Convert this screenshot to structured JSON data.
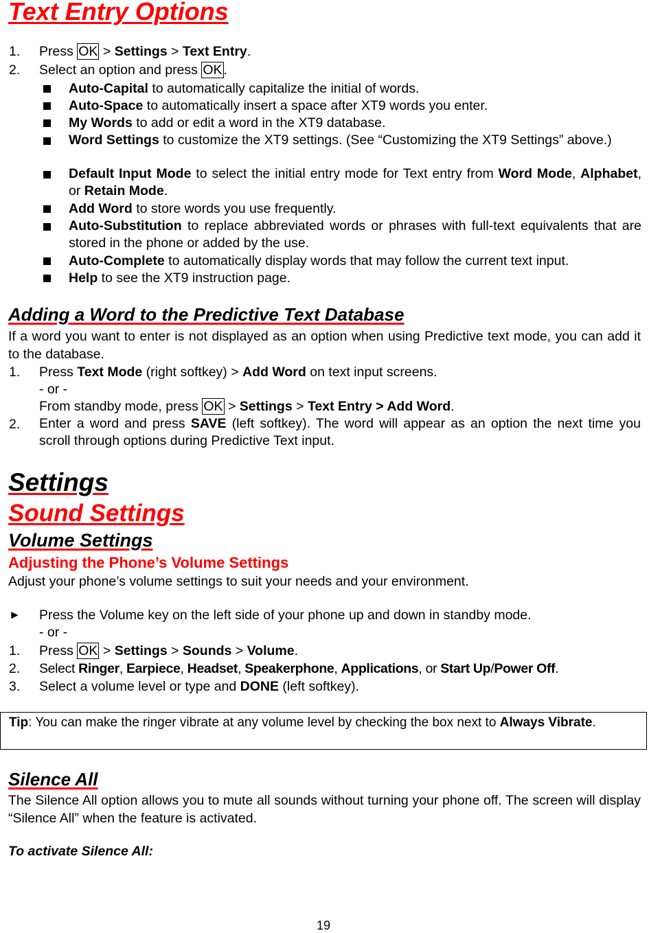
{
  "page_number": "19",
  "sections": {
    "text_entry": {
      "title": "Text Entry Options",
      "steps": [
        {
          "num": "1.",
          "pre": "Press ",
          "key": "OK",
          "mid1": " > ",
          "b1": "Settings",
          "mid2": " > ",
          "b2": "Text Entry",
          "end": "."
        },
        {
          "num": "2.",
          "pre": "Select an option and press ",
          "key": "OK",
          "end": "."
        }
      ],
      "options": [
        {
          "term": "Auto-Capital",
          "desc": " to automatically capitalize the initial of words."
        },
        {
          "term": "Auto-Space",
          "desc": " to automatically insert a space after XT9 words you enter."
        },
        {
          "term": "My Words",
          "desc": " to add or edit a word in the XT9 database."
        },
        {
          "term": "Word Settings",
          "desc": " to customize the XT9 settings. (See “Customizing the XT9 Settings” above.)"
        },
        {
          "term": "Default Input Mode",
          "desc": " to select the initial entry mode for Text entry from ",
          "b1": "Word Mode",
          "s1": ", ",
          "b2": "Alphabet",
          "s2": ", or ",
          "b3": "Retain Mode",
          "end": "."
        },
        {
          "term": "Add Word",
          "desc": " to store words you use frequently."
        },
        {
          "term": "Auto-Substitution",
          "desc": " to replace abbreviated words or phrases with full-text equivalents that are stored in the phone or added by the use."
        },
        {
          "term": "Auto-Complete",
          "desc": " to automatically display words that may follow the current text input."
        },
        {
          "term": "Help",
          "desc": " to see the XT9 instruction page."
        }
      ]
    },
    "adding_word": {
      "title": "Adding a Word to the Predictive Text Database",
      "intro": "If a word you want to enter is not displayed as an option when using Predictive text mode, you can add it to the database.",
      "step1": {
        "num": "1.",
        "pre": "Press ",
        "b1": "Text Mode",
        "mid": " (right softkey) > ",
        "b2": "Add Word",
        "end": " on text input screens."
      },
      "or": "- or -",
      "alt": {
        "pre": "From standby mode, press ",
        "key": "OK",
        "m1": " > ",
        "b1": "Settings",
        "m2": " > ",
        "b2": "Text Entry > Add Word",
        "end": "."
      },
      "step2": {
        "num": "2.",
        "pre": "Enter a word and press ",
        "b1": "SAVE",
        "end": " (left softkey). The word will appear as an option the next time you scroll through options during Predictive Text input."
      }
    },
    "settings": {
      "title": "Settings",
      "sound_title": "Sound Settings",
      "volume_title": "Volume Settings",
      "adjusting_title": "Adjusting the Phone’s Volume Settings",
      "adjusting_intro": "Adjust your phone’s volume settings to suit your needs and your environment.",
      "arrow_icon": "►",
      "arrow_text": "Press the Volume key on the left side of your phone up and down in standby mode.",
      "or": "- or -",
      "step1": {
        "num": "1.",
        "pre": "Press ",
        "key": "OK",
        "m1": " > ",
        "b1": "Settings",
        "m2": " > ",
        "b2": "Sounds",
        "m3": " > ",
        "b3": "Volume",
        "end": "."
      },
      "step2": {
        "num": "2.",
        "pre": "Select ",
        "b1": "Ringer",
        "s1": ", ",
        "b2": "Earpiece",
        "s2": ", ",
        "b3": "Headset",
        "s3": ", ",
        "b4": "Speakerphone",
        "s4": ", ",
        "b5": "Applications",
        "s5": ", or ",
        "b6": "Start Up",
        "s6": "/",
        "b7": "Power Off",
        "end": "."
      },
      "step3": {
        "num": "3.",
        "pre": "Select a volume level or type and ",
        "b1": "DONE",
        "end": " (left softkey)."
      },
      "tip": {
        "label": "Tip",
        "text": ": You can make the ringer vibrate at any volume level by checking the box next to ",
        "b1": "Always Vibrate",
        "end": "."
      }
    },
    "silence_all": {
      "title": "Silence All",
      "intro": "The Silence All option allows you to mute all sounds without turning your phone off. The screen will display “Silence All” when the feature is activated.",
      "activate_heading": "To activate Silence All:"
    }
  }
}
